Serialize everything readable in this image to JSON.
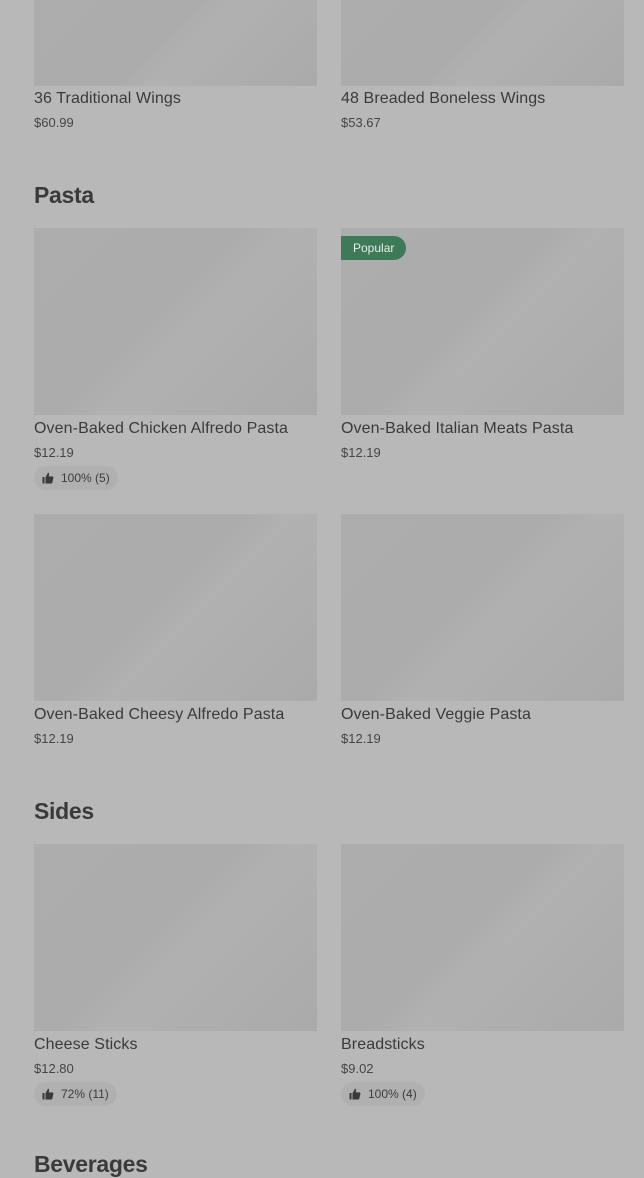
{
  "sections": {
    "wings_items": [
      {
        "name": "36 Traditional Wings",
        "price": "$60.99"
      },
      {
        "name": "48 Breaded Boneless Wings",
        "price": "$53.67"
      }
    ],
    "pasta": {
      "title": "Pasta",
      "badge": "Popular",
      "items": [
        {
          "name": "Oven-Baked Chicken Alfredo Pasta",
          "price": "$12.19",
          "rating": "100% (5)"
        },
        {
          "name": "Oven-Baked Italian Meats Pasta",
          "price": "$12.19"
        },
        {
          "name": "Oven-Baked Cheesy Alfredo Pasta",
          "price": "$12.19"
        },
        {
          "name": "Oven-Baked Veggie Pasta",
          "price": "$12.19"
        }
      ]
    },
    "sides": {
      "title": "Sides",
      "items": [
        {
          "name": "Cheese Sticks",
          "price": "$12.80",
          "rating": "72% (11)"
        },
        {
          "name": "Breadsticks",
          "price": "$9.02",
          "rating": "100% (4)"
        }
      ]
    },
    "beverages": {
      "title": "Beverages"
    }
  },
  "icons": {
    "rating": "thumbs-up-icon"
  },
  "colors": {
    "overlay_background": "#b8b8b8",
    "popular_badge": "#3f7a58"
  }
}
